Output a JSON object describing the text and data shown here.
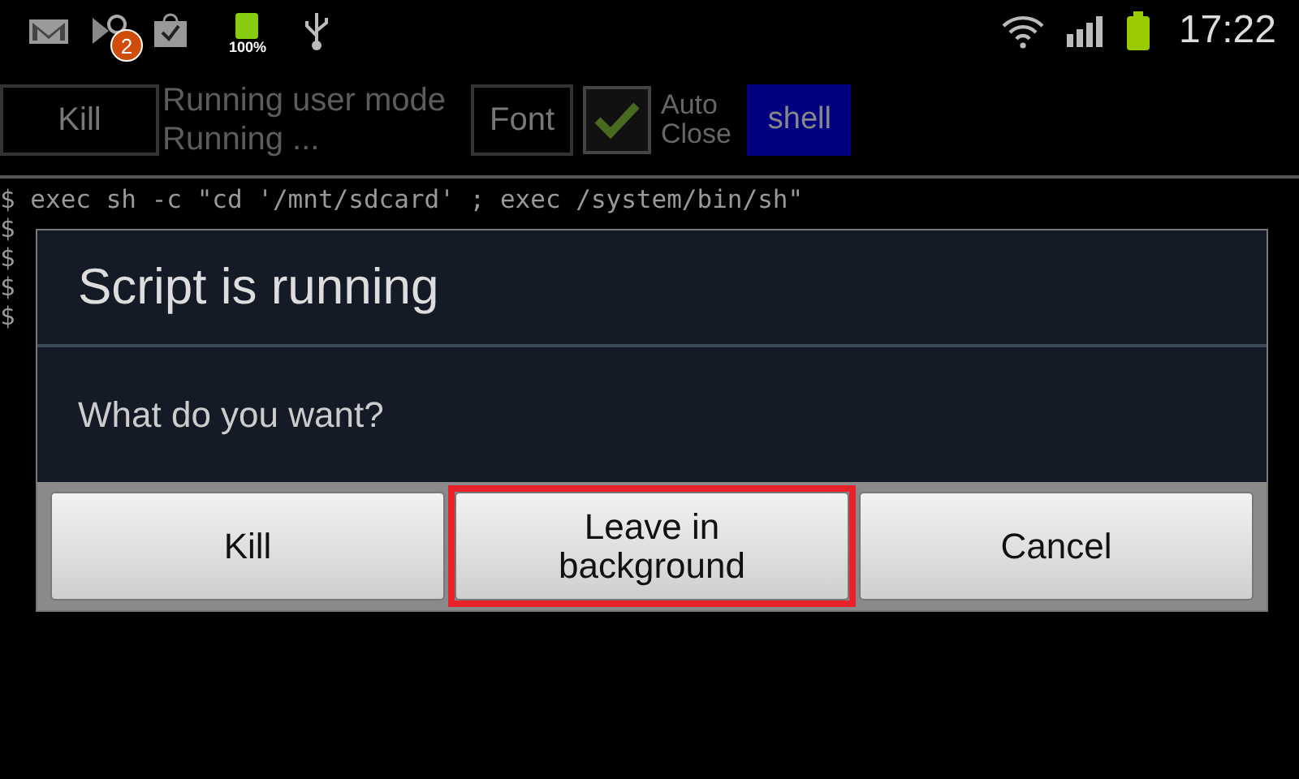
{
  "status_bar": {
    "notification_badge": "2",
    "battery_label": "100%",
    "time": "17:22"
  },
  "toolbar": {
    "kill_button": "Kill",
    "status_title": "Running user mode",
    "status_text": "Running ...",
    "font_button": "Font",
    "auto_close": {
      "label_line1": "Auto",
      "label_line2": "Close",
      "checked": true
    },
    "shell_button": "shell"
  },
  "terminal": {
    "lines": [
      {
        "prompt": "$",
        "command": "exec sh -c \"cd '/mnt/sdcard' ; exec /system/bin/sh\""
      },
      {
        "prompt": "$"
      },
      {
        "prompt": "$"
      },
      {
        "prompt": "$"
      },
      {
        "prompt": "$"
      }
    ]
  },
  "dialog": {
    "title": "Script is running",
    "message": "What do you want?",
    "buttons": [
      {
        "label": "Kill",
        "highlighted": false
      },
      {
        "label": "Leave in background",
        "highlighted": true
      },
      {
        "label": "Cancel",
        "highlighted": false
      }
    ]
  }
}
